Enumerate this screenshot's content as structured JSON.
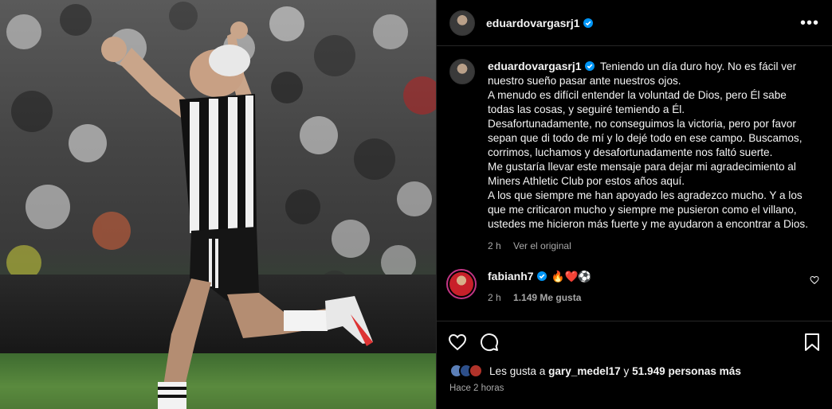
{
  "post": {
    "username": "eduardovargasrj1",
    "image_alt": "Jugador con camiseta a rayas blanco y negro celebrando con los brazos en alto en un estadio lleno"
  },
  "header": {
    "username": "eduardovargasrj1",
    "more_label": "•••"
  },
  "caption": {
    "username": "eduardovargasrj1",
    "text": "Teniendo un día duro hoy. No es fácil ver nuestro sueño pasar ante nuestros ojos.\nA menudo es difícil entender la voluntad de Dios, pero Él sabe todas las cosas, y seguiré temiendo a Él.\nDesafortunadamente, no conseguimos la victoria, pero por favor sepan que di todo de mí y lo dejé todo en ese campo. Buscamos, corrimos, luchamos y desafortunadamente nos faltó suerte.\nMe gustaría llevar este mensaje para dejar mi agradecimiento al Miners Athletic Club por estos años aquí.\nA los que siempre me han apoyado les agradezco mucho. Y a los que me criticaron mucho y siempre me pusieron como el villano, ustedes me hicieron más fuerte y me ayudaron a encontrar a Dios.",
    "time": "2 h",
    "see_translation": "Ver el original"
  },
  "comment": {
    "username": "fabianh7",
    "text": "🔥❤️⚽",
    "time": "2 h",
    "likes": "1.149 Me gusta"
  },
  "likes": {
    "prefix": "Les gusta a ",
    "user": "gary_medel17",
    "middle": " y ",
    "count": "51.949 personas más"
  },
  "timestamp": "Hace 2 horas",
  "colors": {
    "verified": "#0095f6",
    "story_ring": "#c13584",
    "text_secondary": "#a8a8a8",
    "divider": "#262626"
  }
}
